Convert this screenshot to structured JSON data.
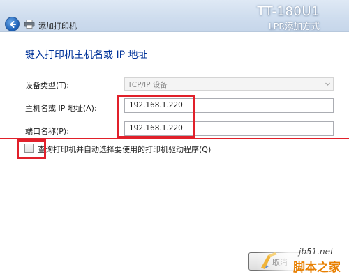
{
  "window": {
    "title": "添加打印机",
    "model_name": "TT-180U1",
    "model_subtitle": "LPR添加方式"
  },
  "page": {
    "heading": "键入打印机主机名或 IP 地址"
  },
  "form": {
    "device_type_label": "设备类型(T):",
    "device_type_value": "TCP/IP 设备",
    "host_label": "主机名或 IP 地址(A):",
    "host_value": "192.168.1.220",
    "port_label": "端口名称(P):",
    "port_value": "192.168.1.220",
    "query_checkbox_label": "查询打印机并自动选择要使用的打印机驱动程序(Q)",
    "query_checked": false
  },
  "footer": {
    "button_label": "取消"
  },
  "watermark": {
    "site": "jb51.net",
    "name": "脚本之家"
  },
  "colors": {
    "annotation_red": "#e1202a",
    "heading_blue": "#003399"
  }
}
